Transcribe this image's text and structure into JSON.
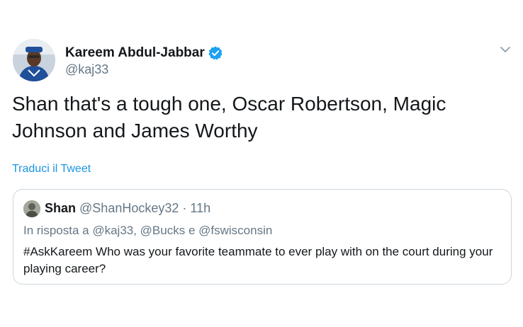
{
  "author": {
    "name": "Kareem Abdul-Jabbar",
    "handle": "@kaj33",
    "verified": true,
    "avatar_icon": "user-avatar"
  },
  "tweet": {
    "text": "Shan that's a tough one, Oscar Robertson, Magic Johnson and James Worthy",
    "translate_label": "Traduci il Tweet"
  },
  "quoted_tweet": {
    "name": "Shan",
    "handle": "@ShanHockey32",
    "separator": "·",
    "time": "11h",
    "reply_context": "In risposta a @kaj33, @Bucks e @fswisconsin",
    "text": "#AskKareem Who was your favorite teammate to ever play with on the court during your playing career?"
  },
  "colors": {
    "link": "#1b95e0",
    "verified_badge": "#1da1f2",
    "secondary_text": "#657786",
    "border": "#ccd6dd"
  }
}
